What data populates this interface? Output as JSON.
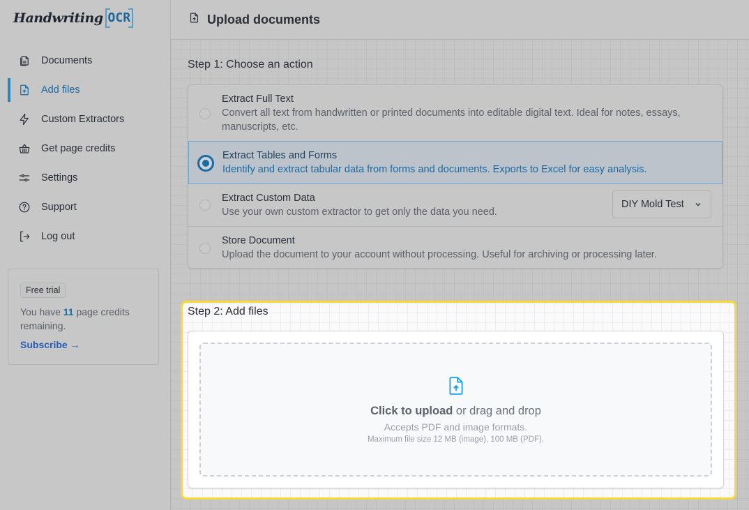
{
  "brand": {
    "script": "Handwriting",
    "mark": "OCR"
  },
  "sidebar": {
    "items": [
      {
        "label": "Documents",
        "icon": "documents-icon",
        "active": false
      },
      {
        "label": "Add files",
        "icon": "file-upload-icon",
        "active": true
      },
      {
        "label": "Custom Extractors",
        "icon": "lightning-icon",
        "active": false
      },
      {
        "label": "Get page credits",
        "icon": "basket-icon",
        "active": false
      },
      {
        "label": "Settings",
        "icon": "sliders-icon",
        "active": false
      },
      {
        "label": "Support",
        "icon": "help-circle-icon",
        "active": false
      },
      {
        "label": "Log out",
        "icon": "logout-icon",
        "active": false
      }
    ],
    "trial": {
      "badge": "Free trial",
      "text_before": "You have ",
      "credits": "11",
      "text_after": " page credits remaining.",
      "subscribe": "Subscribe →"
    }
  },
  "header": {
    "title": "Upload documents",
    "icon": "file-upload-icon"
  },
  "step1": {
    "label": "Step 1: Choose an action",
    "options": [
      {
        "title": "Extract Full Text",
        "desc": "Convert all text from handwritten or printed documents into editable digital text. Ideal for notes, essays, manuscripts, etc.",
        "selected": false
      },
      {
        "title": "Extract Tables and Forms",
        "desc": "Identify and extract tabular data from forms and documents. Exports to Excel for easy analysis.",
        "selected": true
      },
      {
        "title": "Extract Custom Data",
        "desc": "Use your own custom extractor to get only the data you need.",
        "selected": false,
        "dropdown": "DIY Mold Test"
      },
      {
        "title": "Store Document",
        "desc": "Upload the document to your account without processing. Useful for archiving or processing later.",
        "selected": false
      }
    ]
  },
  "step2": {
    "label": "Step 2: Add files",
    "upload": {
      "click": "Click to upload",
      "rest": " or drag and drop",
      "accepts": "Accepts PDF and image formats.",
      "max": "Maximum file size 12 MB (image), 100 MB (PDF)."
    }
  },
  "colors": {
    "accent": "#1b6aa0",
    "highlight": "#fbd93a",
    "upload_icon": "#1ba1e2"
  }
}
